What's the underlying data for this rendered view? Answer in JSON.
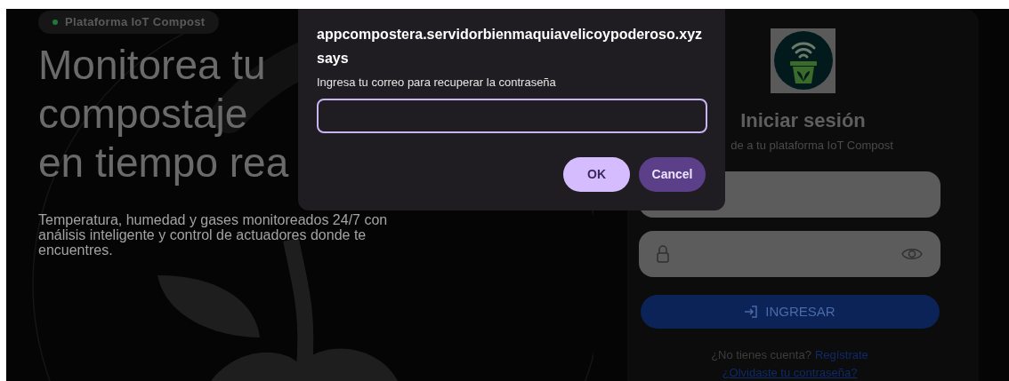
{
  "hero": {
    "badge": {
      "label": "Plataforma IoT Compost",
      "color": "#1f7a3a"
    },
    "headline": [
      "Monitorea tu",
      "compostaje",
      "en tiempo rea"
    ],
    "description": "Temperatura, humedad y gases monitoreados 24/7 con análisis inteligente y control de actuadores donde te encuentres."
  },
  "login": {
    "title": "Iniciar sesión",
    "subtitle": "de a tu plataforma IoT Compost",
    "fields": [
      {
        "kind": "text"
      },
      {
        "kind": "password"
      }
    ],
    "submit": "INGRESAR",
    "signup_prompt": "¿No tienes cuenta?",
    "signup_link": "Regístrate",
    "forgot_link": "¿Olvidaste tu contraseña?"
  },
  "dialog": {
    "title": "appcompostera.servidorbienmaquiavelicoypoderoso.xyz says",
    "message": "Ingresa tu correo para recuperar la contraseña",
    "buttons": [
      {
        "label": "OK",
        "kind": "primary"
      },
      {
        "label": "Cancel",
        "kind": "secondary"
      }
    ]
  }
}
